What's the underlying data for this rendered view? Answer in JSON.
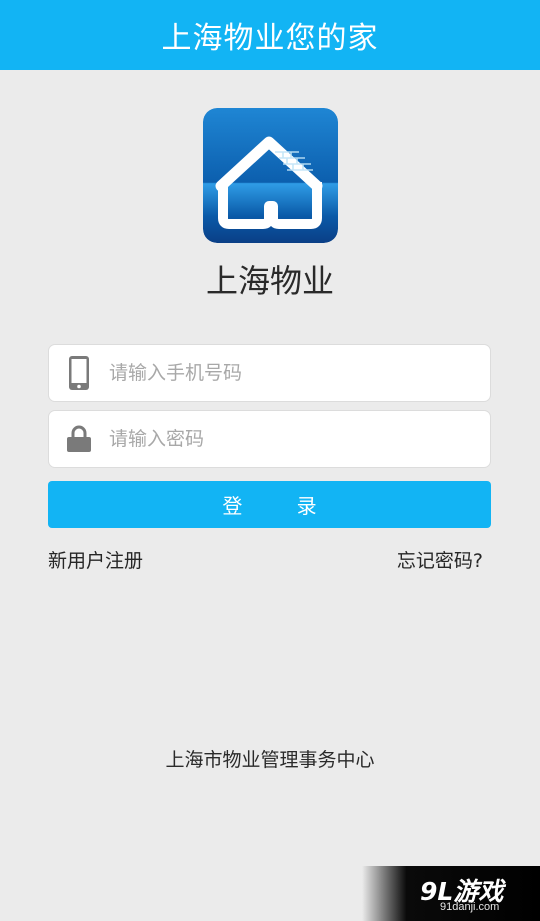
{
  "header": {
    "title": "上海物业您的家"
  },
  "app": {
    "name": "上海物业",
    "logo_icon": "house-logo-icon"
  },
  "form": {
    "phone": {
      "placeholder": "请输入手机号码",
      "value": "",
      "icon": "phone-icon"
    },
    "password": {
      "placeholder": "请输入密码",
      "value": "",
      "icon": "lock-icon"
    },
    "login_label": "登 录"
  },
  "links": {
    "register": "新用户注册",
    "forgot": "忘记密码?"
  },
  "footer": {
    "org": "上海市物业管理事务中心"
  },
  "watermark": {
    "logo": "9L游戏",
    "url": "91danji.com"
  },
  "colors": {
    "accent": "#12b4f4",
    "background": "#ebebeb",
    "icon_gray": "#7a7a7a"
  }
}
